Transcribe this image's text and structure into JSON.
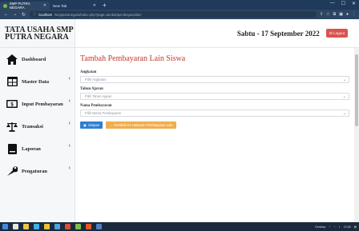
{
  "browser": {
    "tabs": [
      {
        "label": "SMP PUTRA NEGARA",
        "active": true
      },
      {
        "label": "New Tab",
        "active": false
      }
    ],
    "url_host": "localhost",
    "url_path": "/smpputranegara/index.php?page=tambahpembayaranlain"
  },
  "sidebar": {
    "brand_line1": "TATA USAHA SMP",
    "brand_line2": "PUTRA NEGARA",
    "items": [
      {
        "label": "Dashboard",
        "icon": "home-icon",
        "has_chevron": false
      },
      {
        "label": "Master Data",
        "icon": "table-icon",
        "has_chevron": true
      },
      {
        "label": "Input Pembayaran",
        "icon": "money-icon",
        "has_chevron": true
      },
      {
        "label": "Transaksi",
        "icon": "balance-scale-icon",
        "has_chevron": true
      },
      {
        "label": "Laporan",
        "icon": "report-icon",
        "has_chevron": true
      },
      {
        "label": "Pengaturan",
        "icon": "wrench-icon",
        "has_chevron": true
      }
    ]
  },
  "header": {
    "date": "Sabtu - 17 September 2022",
    "logout_label": "Di Logout"
  },
  "form": {
    "title": "Tambah Pembayaran Lain Siswa",
    "fields": [
      {
        "label": "Angkatan",
        "placeholder": "Pilih Angkatan"
      },
      {
        "label": "Tahun Ajaran",
        "placeholder": "Pilih Tahun Ajaran"
      },
      {
        "label": "Nama Pembayaran",
        "placeholder": "Pilih Nama Pembayaran"
      }
    ],
    "save_label": "Simpan",
    "back_label": "Kembali Ke Halaman Pembayaran Lain"
  },
  "taskbar": {
    "tray_label": "Desktop",
    "time": "13:48"
  },
  "colors": {
    "accent_red": "#c0392b",
    "save_blue": "#2f7fd1",
    "back_orange": "#f0ad4e",
    "logout_red": "#d9534f"
  }
}
